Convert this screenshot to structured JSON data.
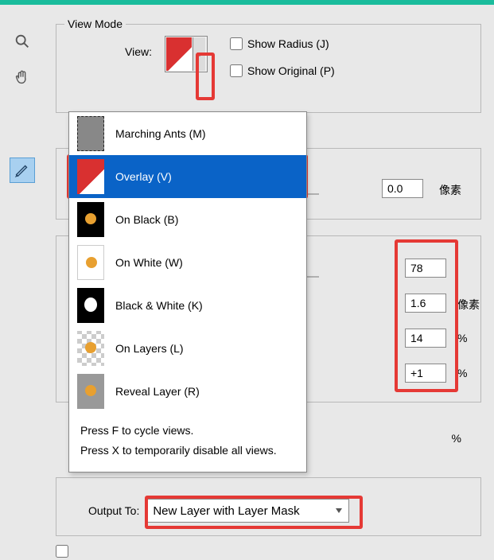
{
  "viewMode": {
    "legend": "View Mode",
    "viewLabel": "View:",
    "showRadius": "Show Radius (J)",
    "showOriginal": "Show Original (P)"
  },
  "dropdown": {
    "items": [
      {
        "label": "Marching Ants (M)",
        "icon": "marching"
      },
      {
        "label": "Overlay (V)",
        "icon": "overlay",
        "selected": true
      },
      {
        "label": "On Black (B)",
        "icon": "onblack"
      },
      {
        "label": "On White (W)",
        "icon": "onwhite"
      },
      {
        "label": "Black & White (K)",
        "icon": "bw"
      },
      {
        "label": "On Layers (L)",
        "icon": "onlayers"
      },
      {
        "label": "Reveal Layer (R)",
        "icon": "reveal"
      }
    ],
    "footer1": "Press F to cycle views.",
    "footer2": "Press X to temporarily disable all views."
  },
  "edge": {
    "radius": "0.0",
    "radiusUnit": "像素"
  },
  "global": {
    "val1": "78",
    "val2": "1.6",
    "val2Unit": "像素",
    "val3": "14",
    "val3Unit": "%",
    "val4": "+1",
    "val4Unit": "%"
  },
  "box4PctUnit": "%",
  "output": {
    "label": "Output To:",
    "value": "New Layer with Layer Mask"
  }
}
